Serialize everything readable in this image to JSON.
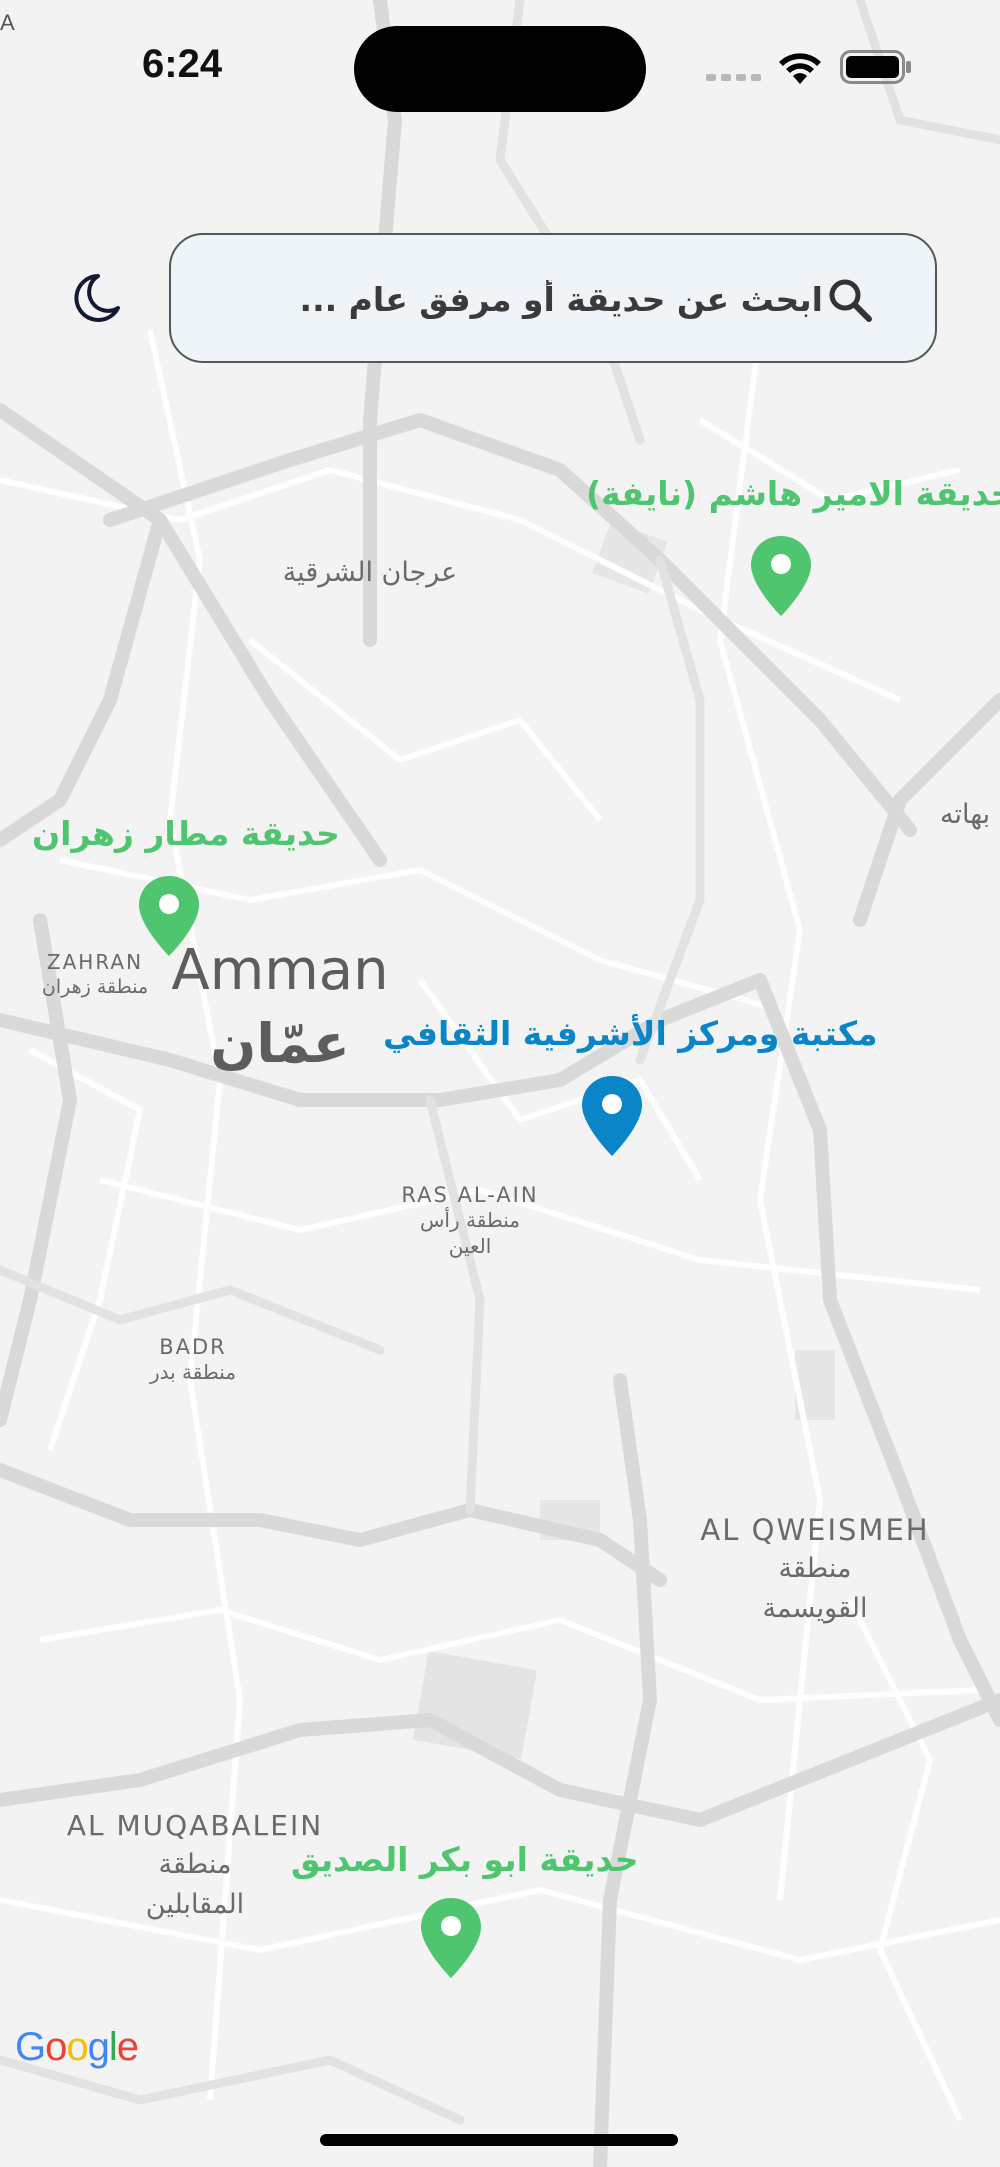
{
  "status_bar": {
    "time": "6:24",
    "corner_char": "A"
  },
  "search": {
    "placeholder": "ابحث عن حديقة أو مرفق عام ..."
  },
  "map": {
    "attribution": {
      "letters": [
        "G",
        "o",
        "o",
        "g",
        "l",
        "e"
      ],
      "colors": [
        "#4285F4",
        "#EA4335",
        "#FBBC05",
        "#4285F4",
        "#34A853",
        "#EA4335"
      ]
    },
    "area_labels": {
      "east_jarjan": "عرجان الشرقية",
      "zahran_en": "ZAHRAN",
      "zahran_ar": "منطقة زهران",
      "amman_en": "Amman",
      "amman_ar": "عمّان",
      "ras_al_ain_en": "RAS AL-AIN",
      "ras_al_ain_ar1": "منطقة رأس",
      "ras_al_ain_ar2": "العين",
      "badr_en": "BADR",
      "badr_ar": "منطقة بدر",
      "qweismeh_en": "AL QWEISMEH",
      "qweismeh_ar1": "منطقة",
      "qweismeh_ar2": "القويسمة",
      "muqabalein_en": "AL MUQABALEIN",
      "muqabalein_ar1": "منطقة",
      "muqabalein_ar2": "المقابلين",
      "edge_label": "بهاته"
    },
    "places": [
      {
        "name": "حديقة الامير هاشم (نايفة)",
        "type": "park",
        "color": "#4fc56f"
      },
      {
        "name": "حديقة مطار زهران",
        "type": "park",
        "color": "#4fc56f"
      },
      {
        "name": "مكتبة ومركز الأشرفية الثقافي",
        "type": "library",
        "color": "#0a86c8"
      },
      {
        "name": "حديقة ابو بكر الصديق",
        "type": "park",
        "color": "#4fc56f"
      }
    ]
  },
  "icons": {
    "theme_toggle": "moon-icon",
    "search": "search-icon",
    "place_marker": "map-pin-icon"
  }
}
